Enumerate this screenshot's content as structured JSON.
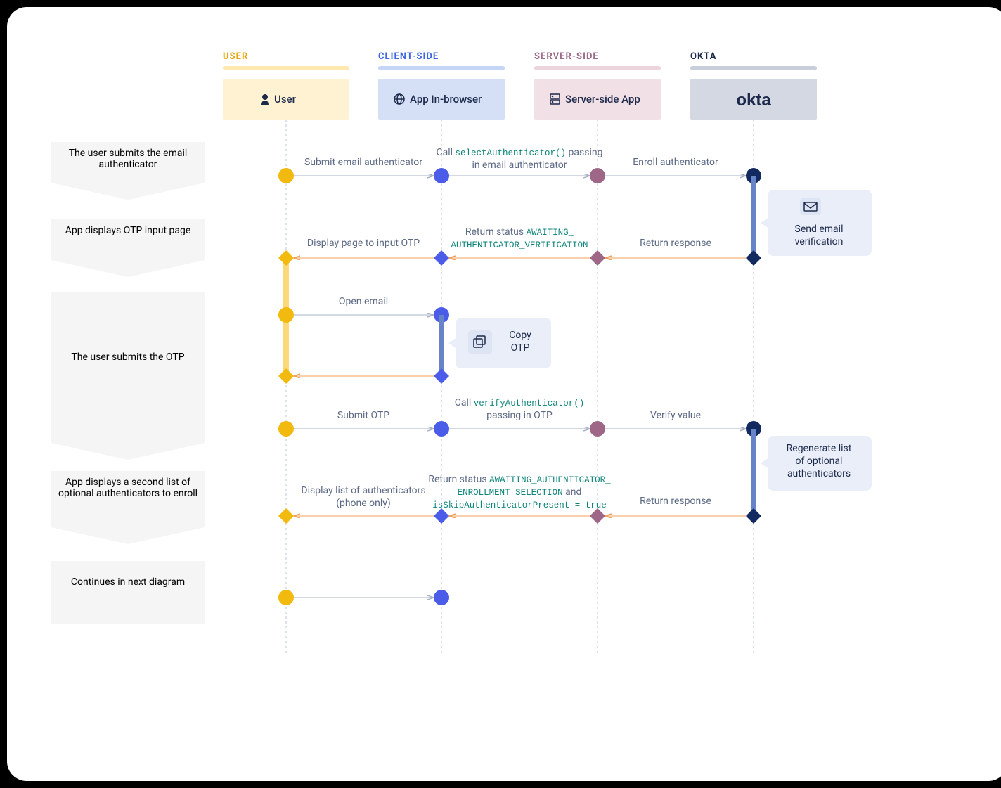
{
  "lanes": {
    "user": {
      "name": "USER",
      "box": "User"
    },
    "client": {
      "name": "CLIENT-SIDE",
      "box": "App In-browser"
    },
    "server": {
      "name": "SERVER-SIDE",
      "box": "Server-side App"
    },
    "okta": {
      "name": "OKTA",
      "box": "okta"
    }
  },
  "steps": {
    "s1": "The user submits the email authenticator",
    "s2": "App displays OTP input page",
    "s3": "The user submits the OTP",
    "s4": "App displays a second list of optional authenticators to enroll",
    "s5": "Continues in next diagram"
  },
  "msgs": {
    "m1": "Submit email authenticator",
    "m2a": "Call ",
    "m2b": "selectAuthenticator()",
    "m2c": " passing",
    "m2d": "in email authenticator",
    "m3": "Enroll authenticator",
    "n1": "Send email verification",
    "m4": "Return response",
    "m5a": "Return status ",
    "m5b": "AWAITING_",
    "m5c": "AUTHENTICATOR_VERIFICATION",
    "m6": "Display page to input OTP",
    "m7": "Open email",
    "n2": "Copy OTP",
    "m8": "Submit OTP",
    "m9a": "Call ",
    "m9b": "verifyAuthenticator()",
    "m9c": "passing in OTP",
    "m10": "Verify value",
    "n3": "Regenerate list of optional authenticators",
    "m11": "Return response",
    "m12a": "Return status ",
    "m12b": "AWAITING_AUTHENTICATOR_",
    "m12c": "ENROLLMENT_SELECTION",
    "m12d": " and",
    "m12e": "isSkipAuthenticatorPresent = true",
    "m13a": "Display list of authenticators",
    "m13b": "(phone only)"
  }
}
